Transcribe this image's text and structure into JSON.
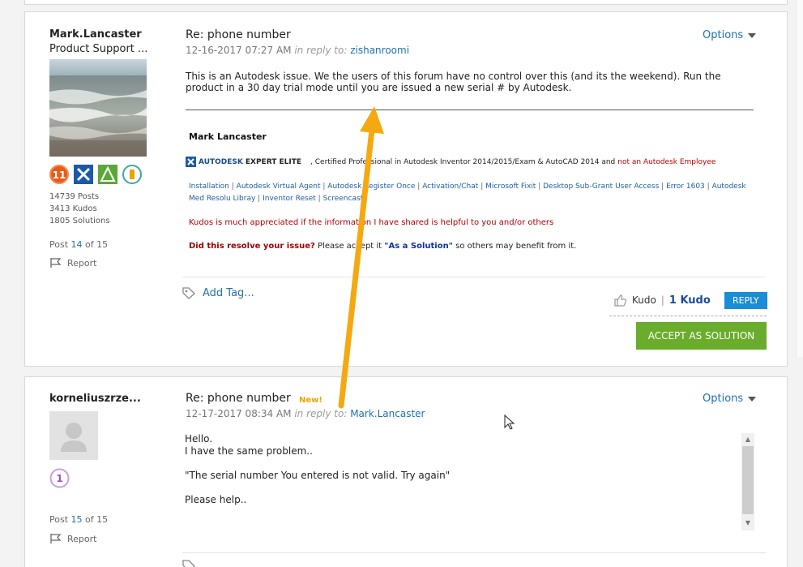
{
  "post1": {
    "author": "Mark.Lancaster",
    "rank": "Product Support ...",
    "stats": [
      "14739 Posts",
      "3413 Kudos",
      "1805 Solutions"
    ],
    "post_label": "Post",
    "post_index": "14",
    "post_of": "of 15",
    "report_label": "Report",
    "subject": "Re: phone number",
    "date": "12-16-2017 07:27 AM",
    "in_reply_label": "in reply to:",
    "in_reply_user": "zishanroomi",
    "options_label": "Options",
    "body": "This is an Autodesk issue.  We the users of this forum have no control over this (and its the weekend).  Run the product in a 30 day trial mode until you are issued a new serial # by Autodesk.",
    "signature": {
      "name": "Mark Lancaster",
      "elite_brand": "AUTODESK",
      "elite_title": "EXPERT ELITE",
      "certified_text": ", Certified Professional in Autodesk Inventor 2014/2015/Exam & AutoCAD 2014 and",
      "not_employee": "not an Autodesk Employee",
      "links": [
        "Installation",
        "Autodesk Virtual Agent",
        "Autodesk Register Once",
        "Activation/Chat",
        "Microsoft Fixit",
        "Desktop Sub-Grant User Access",
        "Error 1603",
        "Autodesk Med Resolu Libray",
        "Inventor Reset",
        "Screencast"
      ],
      "kudos_note": "Kudos is much appreciated if the information I have shared is helpful to you and/or others",
      "resolve_q": "Did this resolve your issue?",
      "resolve_mid": "Please accept it",
      "resolve_solution": "\"As a Solution\"",
      "resolve_end": "so others may benefit from it."
    },
    "add_tag_label": "Add Tag...",
    "kudo_label": "Kudo",
    "kudo_count": "1 Kudo",
    "reply_label": "REPLY",
    "accept_label": "ACCEPT AS SOLUTION"
  },
  "post2": {
    "author": "korneliuszrze...",
    "post_label": "Post",
    "post_index": "15",
    "post_of": "of 15",
    "report_label": "Report",
    "subject": "Re: phone number",
    "new_badge": "New!",
    "date": "12-17-2017 08:34 AM",
    "in_reply_label": "in reply to:",
    "in_reply_user": "Mark.Lancaster",
    "options_label": "Options",
    "body_lines": [
      "Hello.",
      "I have the same problem..",
      "",
      "\"The serial number You entered is not valid. Try again\"",
      "",
      "Please help.."
    ]
  },
  "colors": {
    "link": "#2070b0",
    "reply": "#1a8cd8",
    "accept": "#6aac2c",
    "arrow": "#f5a80f",
    "new": "#e8a400"
  }
}
